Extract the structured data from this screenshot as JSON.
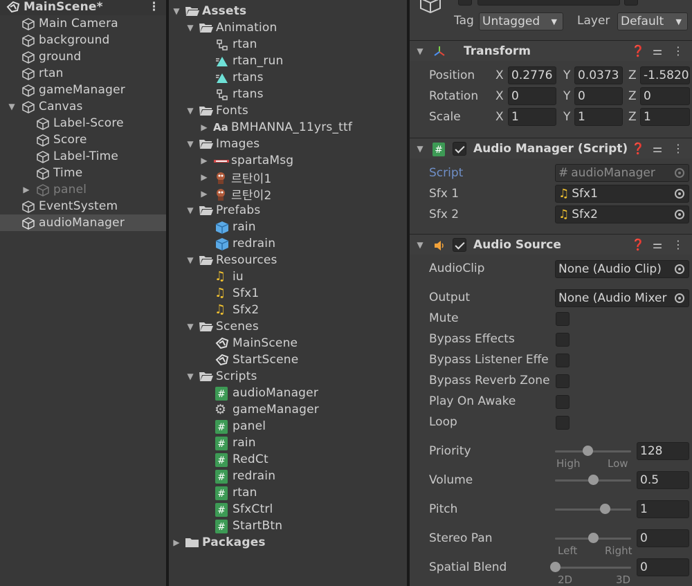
{
  "hierarchy": {
    "scene": "MainScene*",
    "items": [
      {
        "label": "Main Camera"
      },
      {
        "label": "background"
      },
      {
        "label": "ground"
      },
      {
        "label": "rtan"
      },
      {
        "label": "gameManager"
      },
      {
        "label": "Canvas"
      },
      {
        "label": "Label-Score"
      },
      {
        "label": "Score"
      },
      {
        "label": "Label-Time"
      },
      {
        "label": "Time"
      },
      {
        "label": "panel"
      },
      {
        "label": "EventSystem"
      },
      {
        "label": "audioManager"
      }
    ]
  },
  "project": {
    "items": [
      {
        "label": "Assets"
      },
      {
        "label": "Animation"
      },
      {
        "label": "rtan"
      },
      {
        "label": "rtan_run"
      },
      {
        "label": "rtans"
      },
      {
        "label": "rtans"
      },
      {
        "label": "Fonts"
      },
      {
        "label": "BMHANNA_11yrs_ttf"
      },
      {
        "label": "Images"
      },
      {
        "label": "spartaMsg"
      },
      {
        "label": "르탄이1"
      },
      {
        "label": "르탄이2"
      },
      {
        "label": "Prefabs"
      },
      {
        "label": "rain"
      },
      {
        "label": "redrain"
      },
      {
        "label": "Resources"
      },
      {
        "label": "iu"
      },
      {
        "label": "Sfx1"
      },
      {
        "label": "Sfx2"
      },
      {
        "label": "Scenes"
      },
      {
        "label": "MainScene"
      },
      {
        "label": "StartScene"
      },
      {
        "label": "Scripts"
      },
      {
        "label": "audioManager"
      },
      {
        "label": "gameManager"
      },
      {
        "label": "panel"
      },
      {
        "label": "rain"
      },
      {
        "label": "RedCt"
      },
      {
        "label": "redrain"
      },
      {
        "label": "rtan"
      },
      {
        "label": "SfxCtrl"
      },
      {
        "label": "StartBtn"
      },
      {
        "label": "Packages"
      }
    ]
  },
  "inspector": {
    "tag_label": "Tag",
    "tag_value": "Untagged",
    "layer_label": "Layer",
    "layer_value": "Default",
    "transform": {
      "title": "Transform",
      "position_label": "Position",
      "rotation_label": "Rotation",
      "scale_label": "Scale",
      "x": "X",
      "y": "Y",
      "z": "Z",
      "position": [
        "0.2776",
        "0.0373",
        "-1.5820"
      ],
      "rotation": [
        "0",
        "0",
        "0"
      ],
      "scale": [
        "1",
        "1",
        "1"
      ]
    },
    "audio_manager": {
      "title": "Audio Manager (Script)",
      "script_label": "Script",
      "script_value": "audioManager",
      "sfx1_label": "Sfx 1",
      "sfx1_value": "Sfx1",
      "sfx2_label": "Sfx 2",
      "sfx2_value": "Sfx2"
    },
    "audio_source": {
      "title": "Audio Source",
      "audioclip_label": "AudioClip",
      "audioclip_value": "None (Audio Clip)",
      "output_label": "Output",
      "output_value": "None (Audio Mixer",
      "mute": "Mute",
      "bypass_effects": "Bypass Effects",
      "bypass_listener": "Bypass Listener Effe",
      "bypass_reverb": "Bypass Reverb Zone",
      "play_on_awake": "Play On Awake",
      "loop": "Loop",
      "priority_label": "Priority",
      "priority_value": "128",
      "priority_level": 0.43,
      "priority_min": "High",
      "priority_max": "Low",
      "volume_label": "Volume",
      "volume_value": "0.5",
      "volume_level": 0.5,
      "pitch_label": "Pitch",
      "pitch_value": "1",
      "pitch_level": 0.65,
      "stereo_label": "Stereo Pan",
      "stereo_value": "0",
      "stereo_level": 0.5,
      "stereo_min": "Left",
      "stereo_max": "Right",
      "spatial_label": "Spatial Blend",
      "spatial_value": "0",
      "spatial_level": 0.0,
      "spatial_min": "2D",
      "spatial_max": "3D"
    }
  }
}
